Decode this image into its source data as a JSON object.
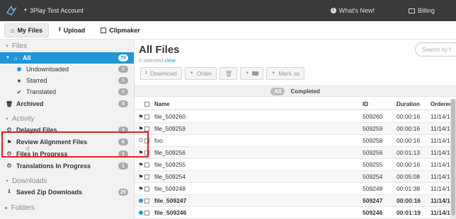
{
  "topbar": {
    "account": "3Play Test Account",
    "whats_new": "What's New!",
    "billing": "Billing"
  },
  "tabs": [
    {
      "label": "My Files",
      "icon": "home-icon"
    },
    {
      "label": "Upload",
      "icon": "upload-icon"
    },
    {
      "label": "Clipmaker",
      "icon": "film-icon"
    }
  ],
  "sidebar": {
    "files_heading": "Files",
    "all": {
      "label": "All",
      "count": "79"
    },
    "undownloaded": {
      "label": "Undownloaded",
      "count": "3"
    },
    "starred": {
      "label": "Starred",
      "count": "6"
    },
    "translated": {
      "label": "Translated",
      "count": "4"
    },
    "archived": {
      "label": "Archived",
      "count": "0"
    },
    "activity_heading": "Activity",
    "delayed": {
      "label": "Delayed Files",
      "count": "1"
    },
    "review": {
      "label": "Review Alignment Files",
      "count": "6"
    },
    "inprogress": {
      "label": "Files In Progress",
      "count": "1"
    },
    "translations": {
      "label": "Translations In Progress",
      "count": "1"
    },
    "downloads_heading": "Downloads",
    "saved_zip": {
      "label": "Saved Zip Downloads",
      "count": "25"
    },
    "folders_heading": "Folders"
  },
  "main": {
    "title": "All Files",
    "selected_text": "0 selected",
    "clear_link": "clear",
    "search_placeholder": "Search by f",
    "toolbar": {
      "download": "Download",
      "order": "Order",
      "mark_as": "Mark as"
    },
    "filter": {
      "all": "All",
      "completed": "Completed"
    },
    "columns": {
      "name": "Name",
      "id": "ID",
      "duration": "Duration",
      "ordered": "Ordered"
    },
    "rows": [
      {
        "status": "flag",
        "name": "file_509260",
        "id": "509260",
        "duration": "00:00:16",
        "ordered": "11/14/1"
      },
      {
        "status": "flag",
        "name": "file_509259",
        "id": "509259",
        "duration": "00:00:16",
        "ordered": "11/14/1"
      },
      {
        "status": "clock",
        "name": "foo",
        "id": "509258",
        "duration": "00:00:16",
        "ordered": "11/14/1"
      },
      {
        "status": "flag",
        "name": "file_509256",
        "id": "509256",
        "duration": "00:01:13",
        "ordered": "11/14/1"
      },
      {
        "status": "flag",
        "name": "file_509255",
        "id": "509255",
        "duration": "00:00:16",
        "ordered": "11/14/1"
      },
      {
        "status": "flag",
        "name": "file_509254",
        "id": "509254",
        "duration": "00:05:08",
        "ordered": "11/14/1"
      },
      {
        "status": "flag",
        "name": "file_509248",
        "id": "509248",
        "duration": "00:01:38",
        "ordered": "11/14/1"
      },
      {
        "status": "dot",
        "name": "file_509247",
        "id": "509247",
        "duration": "00:00:16",
        "ordered": "11/14/1"
      },
      {
        "status": "dot",
        "name": "file_509246",
        "id": "509246",
        "duration": "00:01:19",
        "ordered": "11/14/1"
      }
    ]
  },
  "colors": {
    "accent": "#1e96d8",
    "topbar": "#3a3a3a",
    "highlight": "#e02020"
  }
}
